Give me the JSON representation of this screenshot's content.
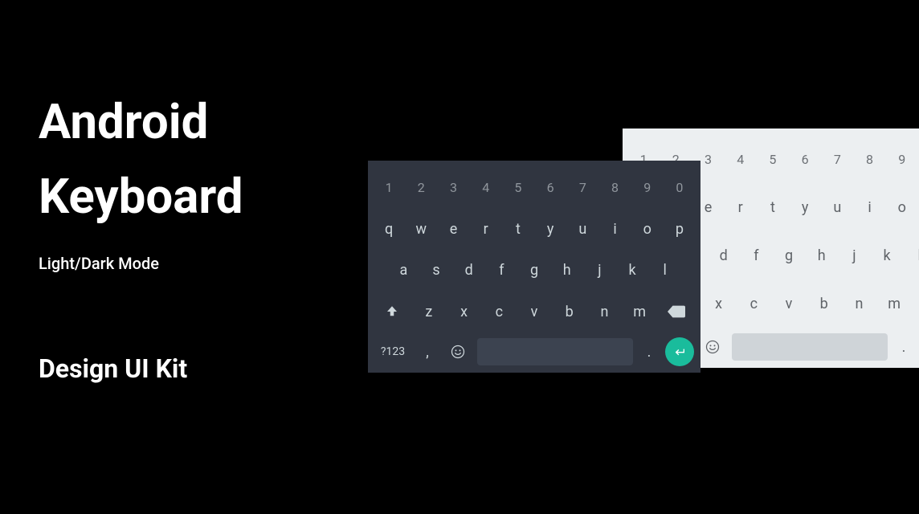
{
  "text": {
    "heading1": "Android",
    "heading2": "Keyboard",
    "subheading": "Light/Dark Mode",
    "footer": "Design UI Kit"
  },
  "keyboard": {
    "row_numbers": [
      "1",
      "2",
      "3",
      "4",
      "5",
      "6",
      "7",
      "8",
      "9",
      "0"
    ],
    "row_top": [
      "q",
      "w",
      "e",
      "r",
      "t",
      "y",
      "u",
      "i",
      "o",
      "p"
    ],
    "row_mid": [
      "a",
      "s",
      "d",
      "f",
      "g",
      "h",
      "j",
      "k",
      "l"
    ],
    "row_bot": [
      "z",
      "x",
      "c",
      "v",
      "b",
      "n",
      "m"
    ],
    "mode_label": "?123",
    "comma": ",",
    "period": "."
  },
  "colors": {
    "dark_bg": "#303540",
    "light_bg": "#eceff1",
    "dark_text": "#cfd8dc",
    "light_text": "#5f6368",
    "accent": "#1abc9c"
  }
}
